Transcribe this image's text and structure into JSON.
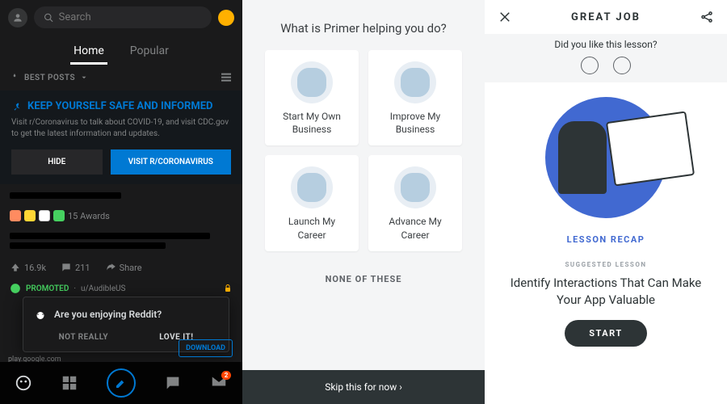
{
  "reddit": {
    "search_placeholder": "Search",
    "tabs": {
      "home": "Home",
      "popular": "Popular"
    },
    "sort_label": "BEST POSTS",
    "banner": {
      "title": "KEEP YOURSELF SAFE AND INFORMED",
      "body": "Visit r/Coronavirus to talk about COVID-19, and visit CDC.gov to get the latest information and updates.",
      "hide": "HIDE",
      "visit": "VISIT R/CORONAVIRUS"
    },
    "awards_text": "15 Awards",
    "post_actions": {
      "upvotes": "16.9k",
      "comments": "211",
      "share": "Share"
    },
    "promoted": {
      "badge": "PROMOTED",
      "user": "u/AudibleUS"
    },
    "overlay": {
      "prompt": "Are you enjoying Reddit?",
      "no": "NOT REALLY",
      "yes": "LOVE IT!"
    },
    "download": "DOWNLOAD",
    "url": "play.google.com",
    "inbox_badge": "2"
  },
  "primer_onboard": {
    "question": "What is Primer helping you do?",
    "cards": [
      "Start My Own Business",
      "Improve My Business",
      "Launch My Career",
      "Advance My Career"
    ],
    "none": "NONE OF THESE",
    "skip": "Skip this for now  ›"
  },
  "primer_done": {
    "title": "GREAT JOB",
    "like_q": "Did you like this lesson?",
    "recap": "LESSON RECAP",
    "suggested_label": "SUGGESTED LESSON",
    "suggested_title": "Identify Interactions That Can Make Your App Valuable",
    "start": "START"
  }
}
